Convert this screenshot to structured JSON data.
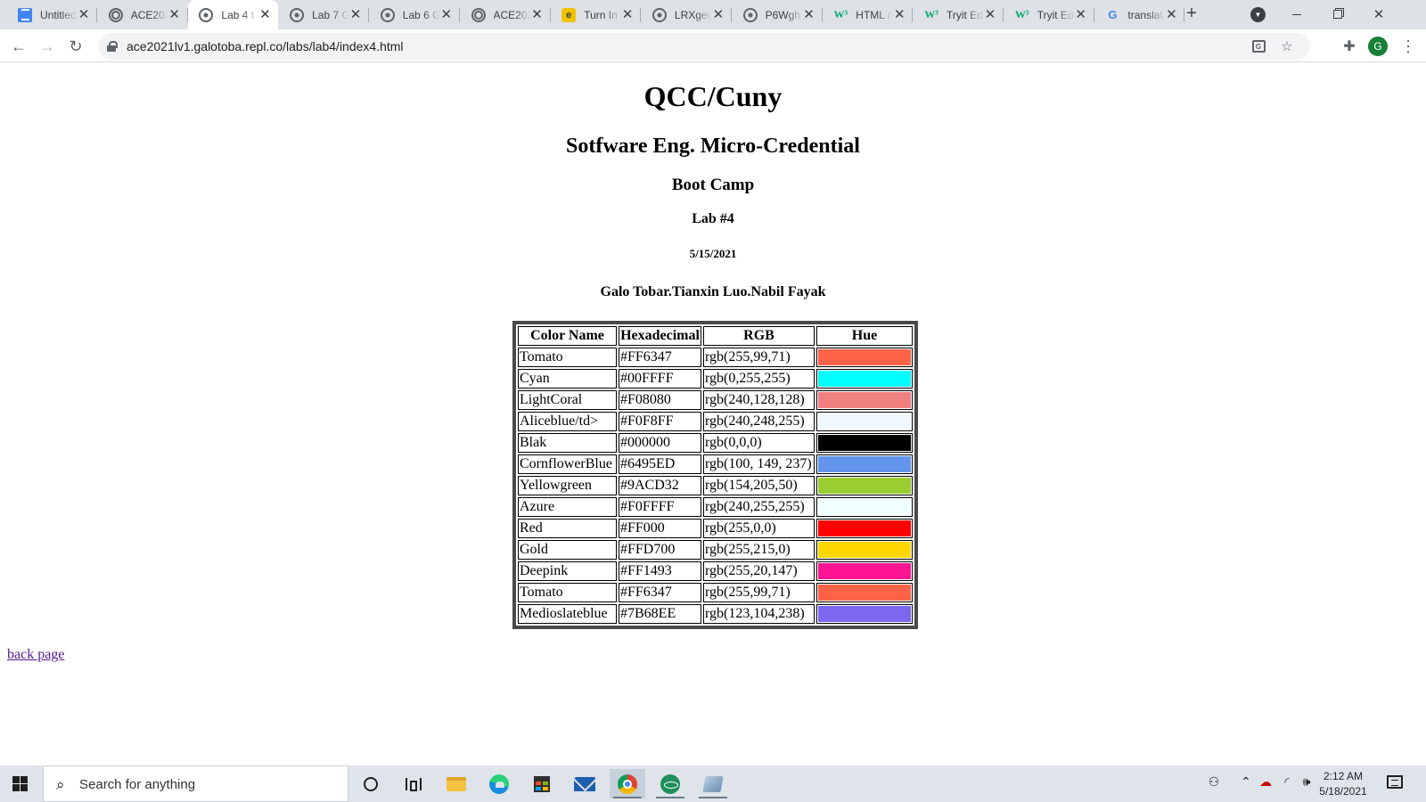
{
  "browser": {
    "tabs": [
      {
        "title": "Untitled",
        "favicon": "docs-icon",
        "active": false
      },
      {
        "title": "ACE2021",
        "favicon": "replit-icon",
        "active": false
      },
      {
        "title": "Lab 4 t",
        "favicon": "globe-icon",
        "active": true
      },
      {
        "title": "Lab 7 G",
        "favicon": "globe-icon",
        "active": false
      },
      {
        "title": "Lab 6 G",
        "favicon": "globe-icon",
        "active": false
      },
      {
        "title": "ACE2021",
        "favicon": "replit-icon",
        "active": false
      },
      {
        "title": "Turn In",
        "favicon": "edpuzzle-icon",
        "active": false
      },
      {
        "title": "LRXgec",
        "favicon": "globe-icon",
        "active": false
      },
      {
        "title": "P6Wgh",
        "favicon": "globe-icon",
        "active": false
      },
      {
        "title": "HTML /",
        "favicon": "w3schools-icon",
        "active": false
      },
      {
        "title": "Tryit Ed",
        "favicon": "w3schools-icon",
        "active": false
      },
      {
        "title": "Tryit Ed",
        "favicon": "w3schools-icon",
        "active": false
      },
      {
        "title": "translat",
        "favicon": "google-icon",
        "active": false
      }
    ],
    "url": "ace2021lv1.galotoba.repl.co/labs/lab4/index4.html",
    "profile_initial": "G"
  },
  "page": {
    "title": "QCC/Cuny",
    "subtitle": "Sotfware Eng. Micro-Credential",
    "program": "Boot Camp",
    "lab": "Lab #4",
    "date": "5/15/2021",
    "authors": "Galo Tobar.Tianxin Luo.Nabil Fayak",
    "table": {
      "headers": [
        "Color Name",
        "Hexadecimal",
        "RGB",
        "Hue"
      ],
      "rows": [
        {
          "name": "Tomato",
          "hex": "#FF6347",
          "rgb": "rgb(255,99,71)",
          "hue": "#FF6347"
        },
        {
          "name": "Cyan",
          "hex": "#00FFFF",
          "rgb": "rgb(0,255,255)",
          "hue": "#00FFFF"
        },
        {
          "name": "LightCoral",
          "hex": "#F08080",
          "rgb": "rgb(240,128,128)",
          "hue": "#F08080"
        },
        {
          "name": "Aliceblue/td>",
          "hex": "#F0F8FF",
          "rgb": "rgb(240,248,255)",
          "hue": "#F0F8FF"
        },
        {
          "name": "Blak",
          "hex": "#000000",
          "rgb": "rgb(0,0,0)",
          "hue": "#000000"
        },
        {
          "name": "CornflowerBlue",
          "hex": "#6495ED",
          "rgb": "rgb(100, 149, 237)",
          "hue": "#6495ED"
        },
        {
          "name": "Yellowgreen",
          "hex": "#9ACD32",
          "rgb": "rgb(154,205,50)",
          "hue": "#9ACD32"
        },
        {
          "name": "Azure",
          "hex": "#F0FFFF",
          "rgb": "rgb(240,255,255)",
          "hue": "#F0FFFF"
        },
        {
          "name": "Red",
          "hex": "#FF000",
          "rgb": "rgb(255,0,0)",
          "hue": "#FF0000"
        },
        {
          "name": "Gold",
          "hex": "#FFD700",
          "rgb": "rgb(255,215,0)",
          "hue": "#FFD700"
        },
        {
          "name": "Deepink",
          "hex": "#FF1493",
          "rgb": "rgb(255,20,147)",
          "hue": "#FF1493"
        },
        {
          "name": "Tomato",
          "hex": "#FF6347",
          "rgb": "rgb(255,99,71)",
          "hue": "#FF6347"
        },
        {
          "name": "Medioslateblue",
          "hex": "#7B68EE",
          "rgb": "rgb(123,104,238)",
          "hue": "#7B68EE"
        }
      ]
    },
    "back_link": "back page"
  },
  "taskbar": {
    "search_placeholder": "Search for anything",
    "clock_time": "2:12 AM",
    "clock_date": "5/18/2021"
  }
}
